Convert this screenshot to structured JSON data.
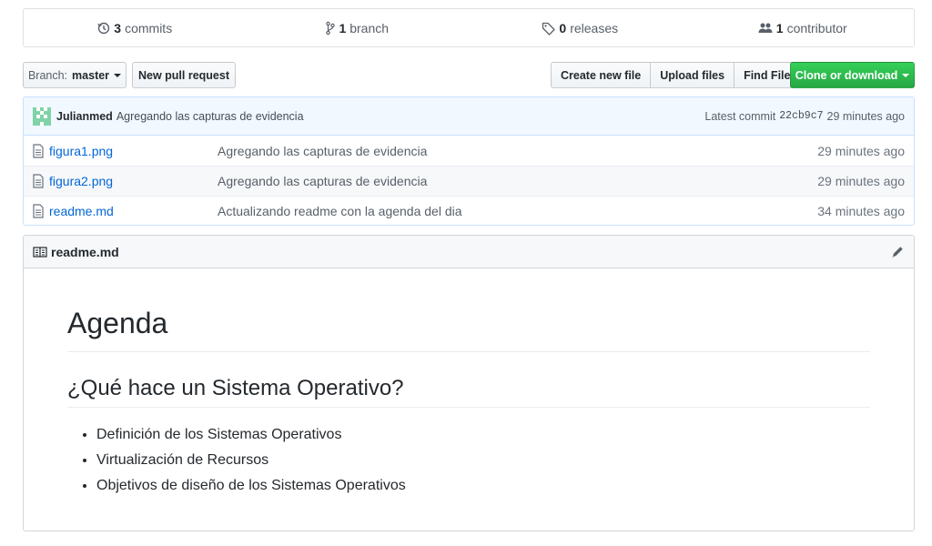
{
  "summary": {
    "commits": {
      "num": "3",
      "label": "commits",
      "icon": "history-icon"
    },
    "branches": {
      "num": "1",
      "label": "branch",
      "icon": "branch-icon"
    },
    "releases": {
      "num": "0",
      "label": "releases",
      "icon": "tag-icon"
    },
    "contributors": {
      "num": "1",
      "label": "contributor",
      "icon": "people-icon"
    }
  },
  "toolbar": {
    "branch_prefix": "Branch:",
    "branch_name": "master",
    "new_pull_request": "New pull request",
    "create_new_file": "Create new file",
    "upload_files": "Upload files",
    "find_file": "Find File",
    "clone_or_download": "Clone or download",
    "accent_green": "#28a745"
  },
  "latest_commit": {
    "author": "Julianmed",
    "message": "Agregando las capturas de evidencia",
    "label": "Latest commit",
    "sha": "22cb9c7",
    "age": "29 minutes ago"
  },
  "files": [
    {
      "name": "figura1.png",
      "message": "Agregando las capturas de evidencia",
      "age": "29 minutes ago"
    },
    {
      "name": "figura2.png",
      "message": "Agregando las capturas de evidencia",
      "age": "29 minutes ago"
    },
    {
      "name": "readme.md",
      "message": "Actualizando readme con la agenda del dia",
      "age": "34 minutes ago"
    }
  ],
  "readme": {
    "filename": "readme.md",
    "h1": "Agenda",
    "h2": "¿Qué hace un Sistema Operativo?",
    "items": [
      "Definición de los Sistemas Operativos",
      "Virtualización de Recursos",
      "Objetivos de diseño de los Sistemas Operativos"
    ]
  }
}
